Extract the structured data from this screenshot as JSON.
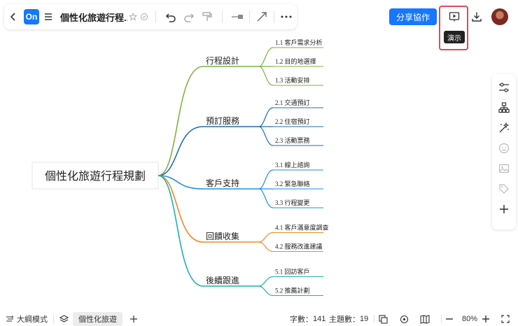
{
  "header": {
    "logo_text": "On",
    "doc_title": "個性化旅遊行程...",
    "share_label": "分享協作",
    "present_tooltip": "演示"
  },
  "mindmap": {
    "root": "個性化旅遊行程規劃",
    "branches": [
      {
        "label": "行程設計",
        "color": "#7cb342",
        "children": [
          "1.1 客戶需求分析",
          "1.2 目的地選擇",
          "1.3 活動安排"
        ]
      },
      {
        "label": "預訂服務",
        "color": "#1f6fb2",
        "children": [
          "2.1 交通預訂",
          "2.2 住宿預訂",
          "2.3 活動票務"
        ]
      },
      {
        "label": "客戶支持",
        "color": "#1e90e0",
        "children": [
          "3.1 線上諮詢",
          "3.2 緊急聯絡",
          "3.3 行程變更"
        ]
      },
      {
        "label": "回饋收集",
        "color": "#f08a24",
        "children": [
          "4.1 客戶滿意度調查",
          "4.2 服務改進建議"
        ]
      },
      {
        "label": "後續跟進",
        "color": "#1fb0b0",
        "children": [
          "5.1 回訪客戶",
          "5.2 推薦計劃"
        ]
      }
    ]
  },
  "bottombar": {
    "outline_mode": "大綱模式",
    "sheet_tab": "個性化旅遊",
    "word_count_label": "字數：",
    "word_count": "141",
    "topic_count_label": "主題數：",
    "topic_count": "19",
    "zoom": "80%"
  }
}
